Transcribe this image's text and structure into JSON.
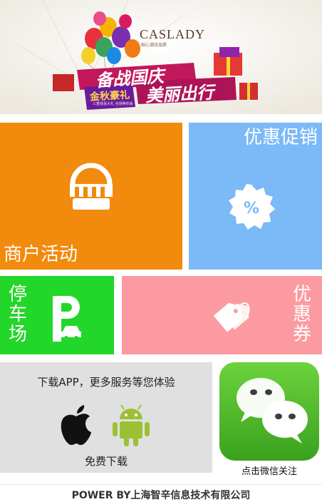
{
  "banner": {
    "brand": "CASLADY",
    "brand_tagline": "贴心潮流品质",
    "headline_1": "备战国庆",
    "headline_2": "美丽出行",
    "badge": "金秋豪礼",
    "badge_sub": "三重惊喜大礼 全场等你来"
  },
  "tiles": {
    "merchant": {
      "label": "商户活动",
      "icon": "shop-awning-icon",
      "color": "#f28a0e"
    },
    "discount": {
      "label": "优惠促销",
      "icon": "percent-badge-icon",
      "color": "#7bb9f7"
    },
    "parking": {
      "label_chars": [
        "停",
        "车",
        "场"
      ],
      "icon": "parking-car-icon",
      "color": "#22d62a"
    },
    "coupon": {
      "label_chars": [
        "优",
        "惠",
        "券"
      ],
      "icon": "price-tag-icon",
      "color": "#fb9aa1"
    }
  },
  "app": {
    "title": "下载APP，更多服务等您体验",
    "download": "免费下载",
    "icons": [
      "apple-icon",
      "android-icon"
    ]
  },
  "wechat": {
    "label": "点击微信关注",
    "icon": "wechat-icon"
  },
  "footer": {
    "text": "POWER BY上海智辛信息技术有限公司"
  }
}
